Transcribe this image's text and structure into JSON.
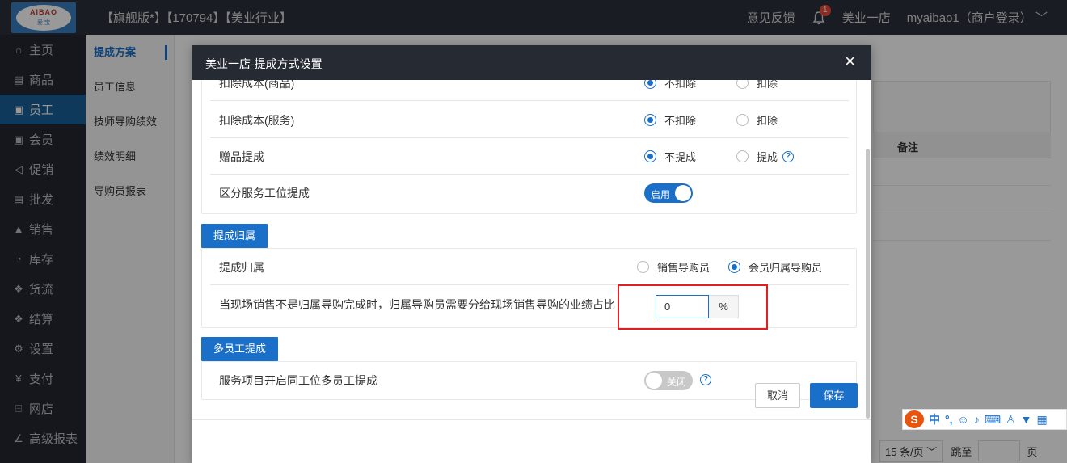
{
  "topbar": {
    "logo_text": "AIBAO",
    "logo_sub": "爱 宝",
    "title": "【旗舰版*】【170794】【美业行业】",
    "feedback": "意见反馈",
    "notification_count": "1",
    "store": "美业一店",
    "user": "myaibao1（商户登录）"
  },
  "sidebar": {
    "items": [
      {
        "label": "主页",
        "icon": "home-icon",
        "glyph": "⌂"
      },
      {
        "label": "商品",
        "icon": "goods-icon",
        "glyph": "▤"
      },
      {
        "label": "员工",
        "icon": "staff-icon",
        "glyph": "▣"
      },
      {
        "label": "会员",
        "icon": "member-icon",
        "glyph": "▣"
      },
      {
        "label": "促销",
        "icon": "promo-icon",
        "glyph": "◁"
      },
      {
        "label": "批发",
        "icon": "wholesale-icon",
        "glyph": "▤"
      },
      {
        "label": "销售",
        "icon": "sales-icon",
        "glyph": "▲"
      },
      {
        "label": "库存",
        "icon": "stock-icon",
        "glyph": "◔"
      },
      {
        "label": "货流",
        "icon": "logistics-icon",
        "glyph": "❖"
      },
      {
        "label": "结算",
        "icon": "settle-icon",
        "glyph": "❖"
      },
      {
        "label": "设置",
        "icon": "settings-icon",
        "glyph": "⚙"
      },
      {
        "label": "支付",
        "icon": "pay-icon",
        "glyph": "¥"
      },
      {
        "label": "网店",
        "icon": "shop-icon",
        "glyph": "⌸"
      },
      {
        "label": "高级报表",
        "icon": "report-icon",
        "glyph": "∠"
      }
    ],
    "active_index": 2
  },
  "subnav": {
    "items": [
      "提成方案",
      "员工信息",
      "技师导购绩效",
      "绩效明细",
      "导购员报表"
    ],
    "active_index": 0
  },
  "background": {
    "table_header": "备注",
    "page_size": "15 条/页",
    "jump_label": "跳至",
    "page_unit": "页"
  },
  "modal": {
    "title": "美业一店-提成方式设置",
    "close": "×",
    "rows": {
      "cost_goods": {
        "label": "扣除成本(商品)",
        "opt1": "不扣除",
        "opt2": "扣除"
      },
      "cost_service": {
        "label": "扣除成本(服务)",
        "opt1": "不扣除",
        "opt2": "扣除"
      },
      "gift": {
        "label": "赠品提成",
        "opt1": "不提成",
        "opt2": "提成"
      },
      "station": {
        "label": "区分服务工位提成",
        "toggle": "启用"
      }
    },
    "section_attribution": {
      "title": "提成归属",
      "row_label": "提成归属",
      "opt1": "销售导购员",
      "opt2": "会员归属导购员",
      "share_label": "当现场销售不是归属导购完成时，归属导购员需要分给现场销售导购的业绩占比",
      "share_value": "0",
      "share_unit": "%"
    },
    "section_multi": {
      "title": "多员工提成",
      "row_label": "服务项目开启同工位多员工提成",
      "toggle": "关闭"
    },
    "cancel": "取消",
    "save": "保存"
  },
  "ime": {
    "logo": "S",
    "lang": "中",
    "punct": "°,"
  }
}
